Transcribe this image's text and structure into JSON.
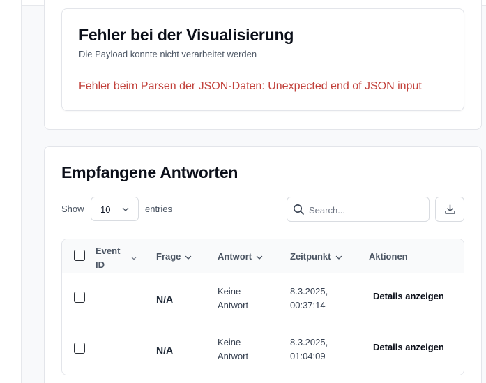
{
  "error_card": {
    "title": "Fehler bei der Visualisierung",
    "subtitle": "Die Payload konnte nicht verarbeitet werden",
    "message": "Fehler beim Parsen der JSON-Daten: Unexpected end of JSON input",
    "message_color": "#c2413b"
  },
  "responses": {
    "title": "Empfangene Antworten",
    "show_label": "Show",
    "entries_value": "10",
    "entries_label": "entries",
    "search_placeholder": "Search...",
    "columns": {
      "event_id_line1": "Event",
      "event_id_line2": "ID",
      "frage": "Frage",
      "antwort": "Antwort",
      "zeitpunkt": "Zeitpunkt",
      "aktionen": "Aktionen"
    },
    "rows": [
      {
        "event_id": "",
        "frage": "N/A",
        "antwort_line1": "Keine",
        "antwort_line2": "Antwort",
        "zeit_line1": "8.3.2025,",
        "zeit_line2": "00:37:14",
        "action": "Details anzeigen"
      },
      {
        "event_id": "",
        "frage": "N/A",
        "antwort_line1": "Keine",
        "antwort_line2": "Antwort",
        "zeit_line1": "8.3.2025,",
        "zeit_line2": "01:04:09",
        "action": "Details anzeigen"
      }
    ]
  },
  "icons": {
    "search": "search-icon",
    "download": "download-icon",
    "chevron": "chevron-down-icon"
  }
}
